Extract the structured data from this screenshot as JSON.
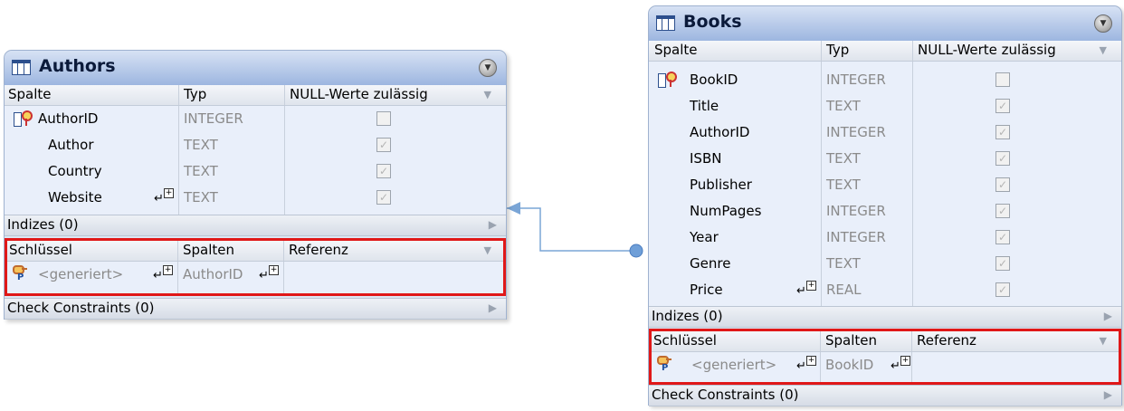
{
  "header_labels": {
    "col_column": "Spalte",
    "col_type": "Typ",
    "col_nullable": "NULL-Werte zulässig",
    "keys_col_key": "Schlüssel",
    "keys_col_columns": "Spalten",
    "keys_col_reference": "Referenz"
  },
  "tables": {
    "authors": {
      "title": "Authors",
      "columns": [
        {
          "name": "AuthorID",
          "type": "INTEGER",
          "nullable": false,
          "primary_key": true
        },
        {
          "name": "Author",
          "type": "TEXT",
          "nullable": true
        },
        {
          "name": "Country",
          "type": "TEXT",
          "nullable": true
        },
        {
          "name": "Website",
          "type": "TEXT",
          "nullable": true
        }
      ],
      "indexes_label": "Indizes (0)",
      "key": {
        "name": "<generiert>",
        "columns": "AuthorID",
        "reference": ""
      },
      "check_label": "Check Constraints (0)"
    },
    "books": {
      "title": "Books",
      "columns": [
        {
          "name": "BookID",
          "type": "INTEGER",
          "nullable": false,
          "primary_key": true
        },
        {
          "name": "Title",
          "type": "TEXT",
          "nullable": true
        },
        {
          "name": "AuthorID",
          "type": "INTEGER",
          "nullable": true
        },
        {
          "name": "ISBN",
          "type": "TEXT",
          "nullable": true
        },
        {
          "name": "Publisher",
          "type": "TEXT",
          "nullable": true
        },
        {
          "name": "NumPages",
          "type": "INTEGER",
          "nullable": true
        },
        {
          "name": "Year",
          "type": "INTEGER",
          "nullable": true
        },
        {
          "name": "Genre",
          "type": "TEXT",
          "nullable": true
        },
        {
          "name": "Price",
          "type": "REAL",
          "nullable": true
        }
      ],
      "indexes_label": "Indizes (0)",
      "key": {
        "name": "<generiert>",
        "columns": "BookID",
        "reference": ""
      },
      "check_label": "Check Constraints (0)"
    }
  },
  "colors": {
    "highlight_border": "#e01818",
    "relation_line": "#7aa5d6",
    "header_gradient_top": "#d7e2f4",
    "header_gradient_bottom": "#9db6e0"
  },
  "icons": {
    "table": "table-icon",
    "collapse": "collapse-icon",
    "primary_key": "primary-key-icon",
    "key": "key-icon",
    "expand_stack": "stack-expand-icon"
  }
}
